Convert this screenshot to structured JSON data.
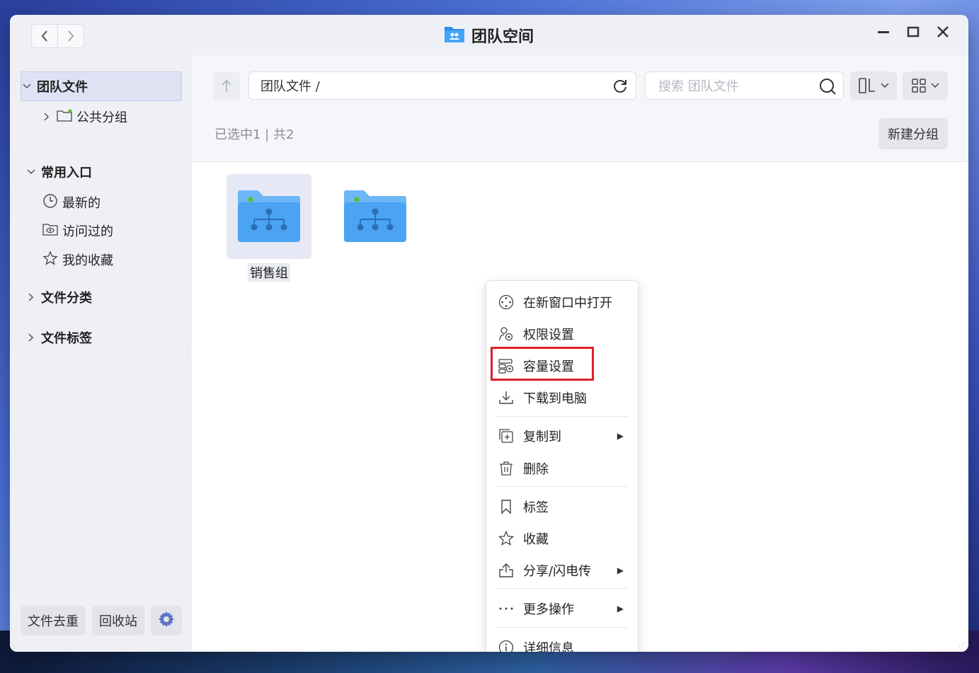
{
  "window": {
    "title": "团队空间",
    "title_icon": "team-folder-icon",
    "nav": {
      "back": "‹",
      "forward": "›"
    },
    "controls": [
      "minimize-icon",
      "maximize-icon",
      "close-icon"
    ]
  },
  "sidebar": {
    "team_files": {
      "label": "团队文件",
      "expanded": true
    },
    "public_group": {
      "label": "公共分组"
    },
    "common_entry": {
      "label": "常用入口",
      "expanded": true
    },
    "recent": {
      "label": "最新的",
      "icon": "clock-icon"
    },
    "visited": {
      "label": "访问过的",
      "icon": "eye-icon"
    },
    "favorites": {
      "label": "我的收藏",
      "icon": "star-icon"
    },
    "file_category": {
      "label": "文件分类"
    },
    "file_tags": {
      "label": "文件标签"
    },
    "bottom": {
      "dedupe": "文件去重",
      "recycle": "回收站",
      "settings_icon": "gear-icon"
    }
  },
  "toolbar": {
    "path": "团队文件 /",
    "search_placeholder": "搜索 团队文件",
    "sort_icon": "sort-icon",
    "view_icon": "grid-view-icon"
  },
  "status": {
    "count_text": "已选中1 | 共2",
    "new_group": "新建分组"
  },
  "folders": [
    {
      "name": "销售组",
      "selected": true
    },
    {
      "name": "",
      "selected": false
    }
  ],
  "context_menu": {
    "items": [
      {
        "label": "在新窗口中打开",
        "icon": "open-window-icon"
      },
      {
        "label": "权限设置",
        "icon": "permission-icon"
      },
      {
        "label": "容量设置",
        "icon": "capacity-settings-icon",
        "highlighted": true
      },
      {
        "label": "下载到电脑",
        "icon": "download-icon"
      },
      {
        "label": "复制到",
        "icon": "copy-to-icon",
        "submenu": true
      },
      {
        "label": "删除",
        "icon": "trash-icon"
      },
      {
        "label": "标签",
        "icon": "bookmark-icon"
      },
      {
        "label": "收藏",
        "icon": "star-icon"
      },
      {
        "label": "分享/闪电传",
        "icon": "share-icon",
        "submenu": true
      },
      {
        "label": "更多操作",
        "icon": "more-icon",
        "submenu": true
      },
      {
        "label": "详细信息",
        "icon": "info-icon"
      }
    ],
    "highlight_color": "#e0202a"
  },
  "colors": {
    "accent": "#3d8fe8",
    "sidebar_bg": "#eef0f5",
    "active_item_bg": "#dfe2f3"
  }
}
